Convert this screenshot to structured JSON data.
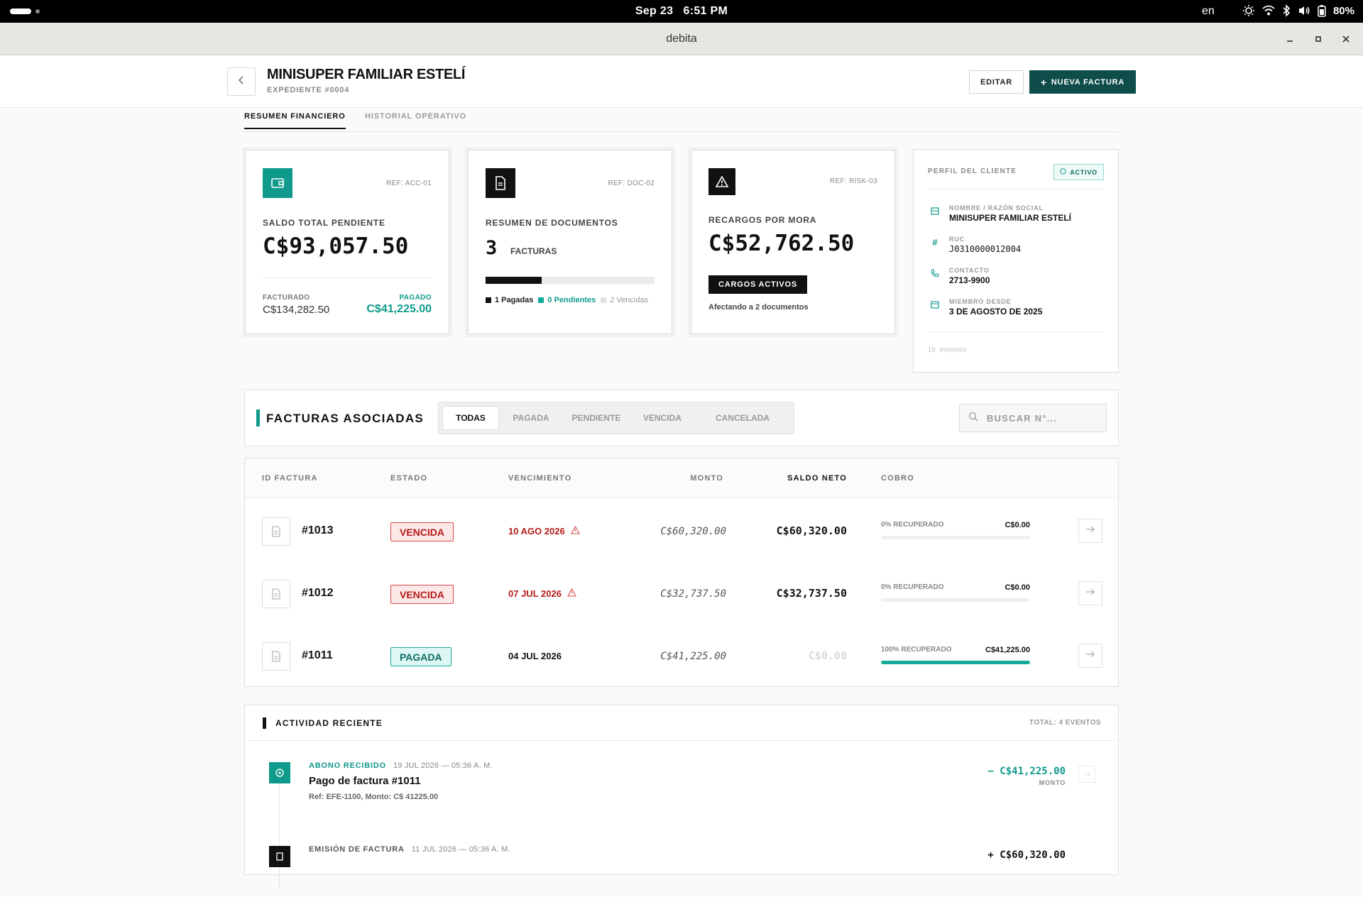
{
  "system": {
    "date": "Sep 23",
    "time": "6:51 PM",
    "lang": "en",
    "battery": "80%"
  },
  "window": {
    "title": "debita"
  },
  "header": {
    "title": "MINISUPER FAMILIAR ESTELÍ",
    "subtitle": "EXPEDIENTE #0004",
    "edit_label": "EDITAR",
    "new_label": "NUEVA FACTURA"
  },
  "tabs": [
    {
      "label": "RESUMEN FINANCIERO"
    },
    {
      "label": "HISTORIAL OPERATIVO"
    }
  ],
  "cards": {
    "saldo": {
      "ref": "REF: ACC-01",
      "label": "SALDO TOTAL PENDIENTE",
      "amount": "C$93,057.50",
      "fact_label": "FACTURADO",
      "fact_value": "C$134,282.50",
      "paid_label": "PAGADO",
      "paid_value": "C$41,225.00"
    },
    "docs": {
      "ref": "REF: DOC-02",
      "label": "RESUMEN DE DOCUMENTOS",
      "count": "3",
      "count_label": "FACTURAS",
      "paid_fraction": 0.333,
      "legend_paid": "1 Pagadas",
      "legend_pending": "0 Pendientes",
      "legend_overdue": "2 Vencidas"
    },
    "mora": {
      "ref": "REF: RISK-03",
      "label": "RECARGOS POR MORA",
      "amount": "C$52,762.50",
      "tag": "CARGOS ACTIVOS",
      "note": "Afectando a 2 documentos"
    }
  },
  "profile": {
    "title": "PERFIL DEL CLIENTE",
    "status": "ACTIVO",
    "name_label": "NOMBRE / RAZÓN SOCIAL",
    "name": "MINISUPER FAMILIAR ESTELÍ",
    "ruc_label": "RUC",
    "ruc": "J0310000012004",
    "contact_label": "CONTACTO",
    "contact": "2713-9900",
    "since_label": "MIEMBRO DESDE",
    "since": "3 DE AGOSTO DE 2025",
    "id": "ID #000004"
  },
  "invoices_bar": {
    "title": "FACTURAS ASOCIADAS",
    "filters": [
      {
        "label": "TODAS"
      },
      {
        "label": "PAGADA"
      },
      {
        "label": "PENDIENTE"
      },
      {
        "label": "VENCIDA"
      },
      {
        "label": "CANCELADA"
      }
    ],
    "search_placeholder": "BUSCAR N°..."
  },
  "table": {
    "headers": {
      "id": "ID FACTURA",
      "estado": "ESTADO",
      "venc": "VENCIMIENTO",
      "monto": "MONTO",
      "saldo": "SALDO NETO",
      "cobro": "COBRO"
    },
    "rows": [
      {
        "id": "#1013",
        "estado": "VENCIDA",
        "venc": "10 AGO 2026",
        "monto": "C$60,320.00",
        "saldo": "C$60,320.00",
        "cobro_label": "0% RECUPERADO",
        "cobro_value": "C$0.00",
        "recovered": 0
      },
      {
        "id": "#1012",
        "estado": "VENCIDA",
        "venc": "07 JUL 2026",
        "monto": "C$32,737.50",
        "saldo": "C$32,737.50",
        "cobro_label": "0% RECUPERADO",
        "cobro_value": "C$0.00",
        "recovered": 0
      },
      {
        "id": "#1011",
        "estado": "PAGADA",
        "venc": "04 JUL 2026",
        "monto": "C$41,225.00",
        "saldo": "C$0.00",
        "cobro_label": "100% RECUPERADO",
        "cobro_value": "C$41,225.00",
        "recovered": 1
      }
    ]
  },
  "activity": {
    "title": "ACTIVIDAD RECIENTE",
    "total": "TOTAL: 4 EVENTOS",
    "events": [
      {
        "type": "ABONO RECIBIDO",
        "time": "19 JUL 2026 — 05:36 A. M.",
        "title": "Pago de factura #1011",
        "desc": "Ref: EFE-1100, Monto: C$ 41225.00",
        "amount": "− C$41,225.00",
        "amount_label": "MONTO"
      },
      {
        "type": "EMISIÓN DE FACTURA",
        "time": "11 JUL 2026 — 05:36 A. M.",
        "title": "",
        "desc": "",
        "amount": "+ C$60,320.00",
        "amount_label": ""
      }
    ]
  },
  "colors": {
    "teal": "#0f9a8c",
    "dark_teal": "#0e4d4a",
    "red": "#b51a1a"
  }
}
